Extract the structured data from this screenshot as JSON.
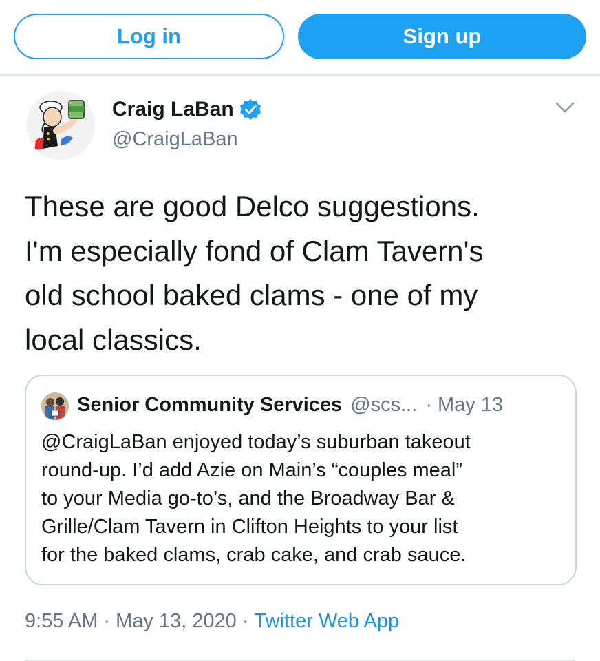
{
  "topbar": {
    "login_label": "Log in",
    "signup_label": "Sign up"
  },
  "tweet": {
    "author": {
      "display_name": "Craig LaBan",
      "handle": "@CraigLaBan",
      "verified": true,
      "avatar_icon": "popeye-cartoon-avatar"
    },
    "menu_icon": "chevron-down-icon",
    "text_lines": [
      "These are good Delco suggestions.",
      "I'm especially fond of Clam Tavern's",
      "old school baked clams - one of my",
      "local classics."
    ],
    "quoted": {
      "display_name": "Senior Community Services",
      "handle": "@scs...",
      "separator": "·",
      "date": "May 13",
      "text_lines": [
        "@CraigLaBan enjoyed today’s suburban takeout",
        "round-up. I’d add Azie on Main’s “couples meal”",
        "to your Media go-to’s, and the Broadway Bar &",
        "Grille/Clam Tavern in Clifton Heights to your list",
        "for the baked clams, crab cake, and crab sauce."
      ]
    },
    "footer": {
      "time": "9:55 AM",
      "separator": "·",
      "date": "May 13, 2020",
      "app": "Twitter Web App"
    }
  },
  "colors": {
    "accent": "#1da1f2",
    "link": "#1b95e0",
    "secondary_text": "#657786",
    "border": "#ccd6dd"
  }
}
